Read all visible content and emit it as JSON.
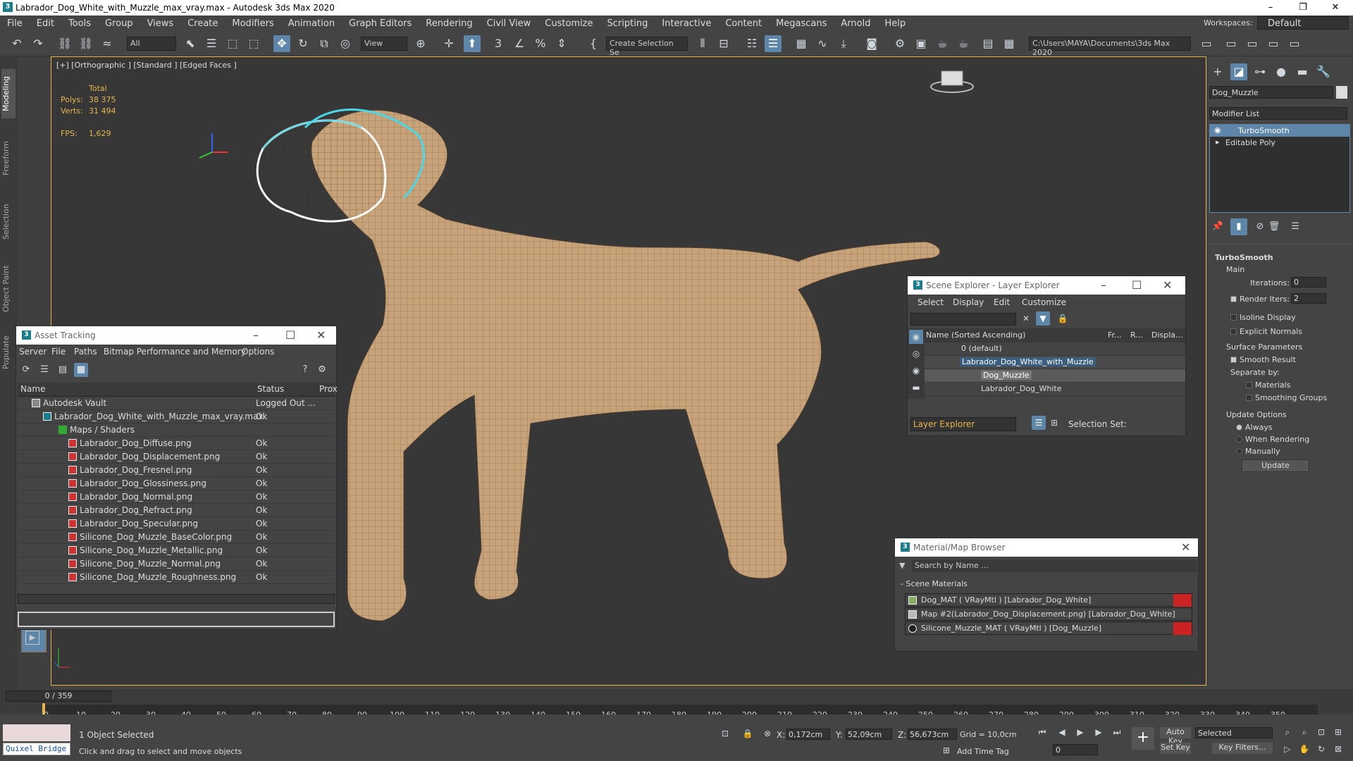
{
  "window": {
    "title": "Labrador_Dog_White_with_Muzzle_max_vray.max - Autodesk 3ds Max 2020",
    "logo": "3"
  },
  "menu": [
    "File",
    "Edit",
    "Tools",
    "Group",
    "Views",
    "Create",
    "Modifiers",
    "Animation",
    "Graph Editors",
    "Rendering",
    "Civil View",
    "Customize",
    "Scripting",
    "Interactive",
    "Content",
    "Megascans",
    "Arnold",
    "Help"
  ],
  "workspace": {
    "label": "Workspaces:",
    "value": "Default"
  },
  "toolbar": {
    "filter": "All",
    "view": "View",
    "selection_set": "Create Selection Se",
    "path": "C:\\Users\\MAYA\\Documents\\3ds Max 2020"
  },
  "left_tabs": [
    "Modeling",
    "Freeform",
    "Selection",
    "Object Paint",
    "Populate"
  ],
  "viewport": {
    "label": "[+] [Orthographic ] [Standard ] [Edged Faces ]",
    "total": "Total",
    "polys_label": "Polys:",
    "polys": "38 375",
    "verts_label": "Verts:",
    "verts": "31 494",
    "fps_label": "FPS:",
    "fps": "1,629"
  },
  "asset_tracking": {
    "title": "Asset Tracking",
    "menu": [
      "Server",
      "File",
      "Paths",
      "Bitmap Performance and Memory",
      "Options"
    ],
    "cols": [
      "Name",
      "Status",
      "Prox"
    ],
    "rows": [
      {
        "name": "Autodesk Vault",
        "status": "Logged Out ..."
      },
      {
        "name": "Labrador_Dog_White_with_Muzzle_max_vray.max",
        "status": "Ok"
      },
      {
        "name": "Maps / Shaders",
        "status": ""
      },
      {
        "name": "Labrador_Dog_Diffuse.png",
        "status": "Ok"
      },
      {
        "name": "Labrador_Dog_Displacement.png",
        "status": "Ok"
      },
      {
        "name": "Labrador_Dog_Fresnel.png",
        "status": "Ok"
      },
      {
        "name": "Labrador_Dog_Glossiness.png",
        "status": "Ok"
      },
      {
        "name": "Labrador_Dog_Normal.png",
        "status": "Ok"
      },
      {
        "name": "Labrador_Dog_Refract.png",
        "status": "Ok"
      },
      {
        "name": "Labrador_Dog_Specular.png",
        "status": "Ok"
      },
      {
        "name": "Silicone_Dog_Muzzle_BaseColor.png",
        "status": "Ok"
      },
      {
        "name": "Silicone_Dog_Muzzle_Metallic.png",
        "status": "Ok"
      },
      {
        "name": "Silicone_Dog_Muzzle_Normal.png",
        "status": "Ok"
      },
      {
        "name": "Silicone_Dog_Muzzle_Roughness.png",
        "status": "Ok"
      }
    ]
  },
  "scene_explorer": {
    "title": "Scene Explorer - Layer Explorer",
    "menu": [
      "Select",
      "Display",
      "Edit",
      "Customize"
    ],
    "cols": [
      "Name (Sorted Ascending)",
      "Fr...",
      "R...",
      "Displa..."
    ],
    "rows": [
      "0 (default)",
      "Labrador_Dog_White_with_Muzzle",
      "Dog_Muzzle",
      "Labrador_Dog_White"
    ],
    "footer": "Layer Explorer",
    "selection_set": "Selection Set:"
  },
  "material_browser": {
    "title": "Material/Map Browser",
    "search": "Search by Name ...",
    "group": "- Scene Materials",
    "items": [
      "Dog_MAT  ( VRayMtl )  [Labrador_Dog_White]",
      "Map #2(Labrador_Dog_Displacement.png) [Labrador_Dog_White]",
      "Silicone_Muzzle_MAT  ( VRayMtl )  [Dog_Muzzle]"
    ]
  },
  "command_panel": {
    "object_name": "Dog_Muzzle",
    "modifier_list": "Modifier List",
    "stack": [
      "TurboSmooth",
      "Editable Poly"
    ],
    "rollout": "TurboSmooth",
    "main": "Main",
    "iterations_label": "Iterations:",
    "iterations": "0",
    "render_iters_label": "Render Iters:",
    "render_iters": "2",
    "isoline": "Isoline Display",
    "explicit": "Explicit Normals",
    "surface": "Surface Parameters",
    "smooth_result": "Smooth Result",
    "separate": "Separate by:",
    "materials": "Materials",
    "smoothing_groups": "Smoothing Groups",
    "update_options": "Update Options",
    "always": "Always",
    "when_rendering": "When Rendering",
    "manually": "Manually",
    "update": "Update"
  },
  "timeline": {
    "frame": "0 / 359",
    "ticks": [
      "0",
      "10",
      "20",
      "30",
      "40",
      "50",
      "60",
      "70",
      "80",
      "90",
      "100",
      "110",
      "120",
      "130",
      "140",
      "150",
      "160",
      "170",
      "180",
      "190",
      "200",
      "210",
      "220",
      "230",
      "240",
      "250",
      "260",
      "270",
      "280",
      "290",
      "300",
      "310",
      "320",
      "330",
      "340",
      "350"
    ]
  },
  "status": {
    "quixel": "Quixel Bridge",
    "selected": "1 Object Selected",
    "hint": "Click and drag to select and move objects",
    "x_label": "X:",
    "x": "0,172cm",
    "y_label": "Y:",
    "y": "52,09cm",
    "z_label": "Z:",
    "z": "56,673cm",
    "grid": "Grid = 10,0cm",
    "add_time_tag": "Add Time Tag",
    "auto_key": "Auto Key",
    "set_key": "Set Key",
    "key_mode": "Selected",
    "key_filters": "Key Filters...",
    "frame_value": "0"
  },
  "colors": {
    "accent": "#5d86a8",
    "viewport_border": "#e9b64a",
    "dog": "#c8a37a"
  }
}
